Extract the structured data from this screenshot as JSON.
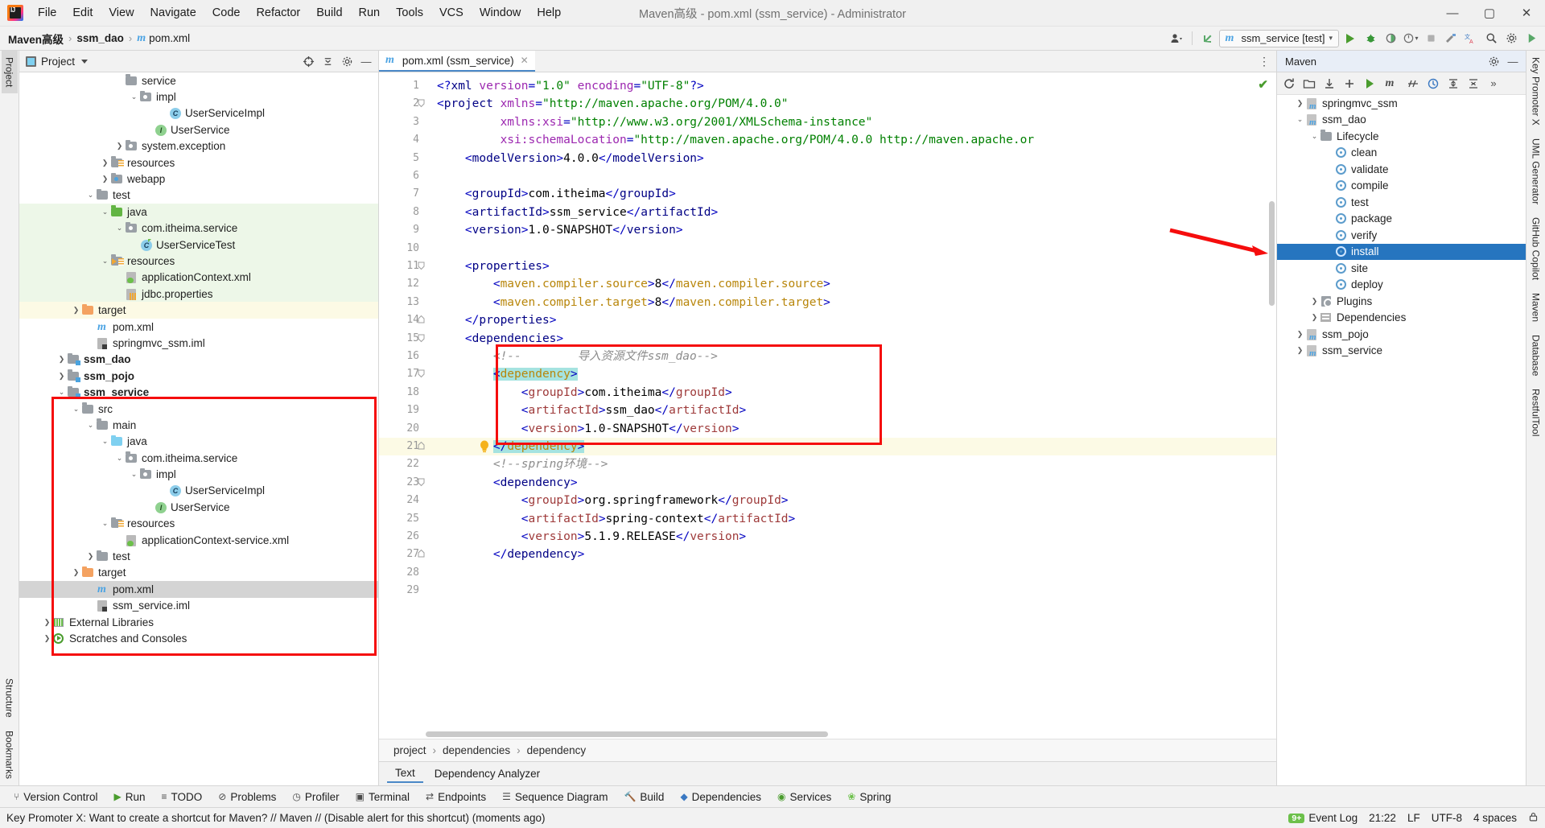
{
  "titlebar": {
    "menus": [
      "File",
      "Edit",
      "View",
      "Navigate",
      "Code",
      "Refactor",
      "Build",
      "Run",
      "Tools",
      "VCS",
      "Window",
      "Help"
    ],
    "window_title": "Maven高级 - pom.xml (ssm_service) - Administrator",
    "minimize": "—",
    "maximize": "▢",
    "close": "✕",
    "logo_name": "intellij-idea-logo"
  },
  "navbar": {
    "crumb1": "Maven高级",
    "crumb2": "ssm_dao",
    "crumb3": "pom.xml",
    "sep": "›",
    "run_config": "ssm_service [test]",
    "run_config_caret": "▾"
  },
  "left_strip": {
    "project_tab": "Project",
    "structure_tab": "Structure",
    "bookmarks_tab": "Bookmarks"
  },
  "right_strip": {
    "tabs": [
      "Key Promoter X",
      "UML Generator",
      "GitHub Copilot",
      "Maven",
      "Database",
      "RestfulTool"
    ]
  },
  "project_panel": {
    "title": "Project",
    "rows": [
      {
        "indent": 6,
        "arrow": "",
        "icon": "folder-grey",
        "label": "service",
        "bg": "",
        "bold": false,
        "clipped": true
      },
      {
        "indent": 7,
        "arrow": "v",
        "icon": "folder-pkg",
        "label": "impl",
        "bg": "",
        "bold": false
      },
      {
        "indent": 9,
        "arrow": "",
        "icon": "class-c",
        "label": "UserServiceImpl",
        "bg": "",
        "bold": false
      },
      {
        "indent": 8,
        "arrow": "",
        "icon": "interface-i",
        "label": "UserService",
        "bg": "",
        "bold": false
      },
      {
        "indent": 6,
        "arrow": ">",
        "icon": "folder-pkg",
        "label": "system.exception",
        "bg": "",
        "bold": false
      },
      {
        "indent": 5,
        "arrow": ">",
        "icon": "folder-res",
        "label": "resources",
        "bg": "",
        "bold": false
      },
      {
        "indent": 5,
        "arrow": ">",
        "icon": "folder-web",
        "label": "webapp",
        "bg": "",
        "bold": false
      },
      {
        "indent": 4,
        "arrow": "v",
        "icon": "folder-grey",
        "label": "test",
        "bg": "",
        "bold": false
      },
      {
        "indent": 5,
        "arrow": "v",
        "icon": "folder-green",
        "label": "java",
        "bg": "green",
        "bold": false
      },
      {
        "indent": 6,
        "arrow": "v",
        "icon": "folder-pkg",
        "label": "com.itheima.service",
        "bg": "green",
        "bold": false
      },
      {
        "indent": 7,
        "arrow": "",
        "icon": "class-test",
        "label": "UserServiceTest",
        "bg": "green",
        "bold": false
      },
      {
        "indent": 5,
        "arrow": "v",
        "icon": "folder-res-t",
        "label": "resources",
        "bg": "green",
        "bold": false
      },
      {
        "indent": 6,
        "arrow": "",
        "icon": "file-xml",
        "label": "applicationContext.xml",
        "bg": "green",
        "bold": false
      },
      {
        "indent": 6,
        "arrow": "",
        "icon": "file-prop",
        "label": "jdbc.properties",
        "bg": "green",
        "bold": false
      },
      {
        "indent": 3,
        "arrow": ">",
        "icon": "folder-orange",
        "label": "target",
        "bg": "yellow",
        "bold": false
      },
      {
        "indent": 4,
        "arrow": "",
        "icon": "file-pom",
        "label": "pom.xml",
        "bg": "",
        "bold": false
      },
      {
        "indent": 4,
        "arrow": "",
        "icon": "file-iml",
        "label": "springmvc_ssm.iml",
        "bg": "",
        "bold": false
      },
      {
        "indent": 2,
        "arrow": ">",
        "icon": "module-maven",
        "label": "ssm_dao",
        "bg": "",
        "bold": true
      },
      {
        "indent": 2,
        "arrow": ">",
        "icon": "module-maven",
        "label": "ssm_pojo",
        "bg": "",
        "bold": true
      },
      {
        "indent": 2,
        "arrow": "v",
        "icon": "module-maven",
        "label": "ssm_service",
        "bg": "",
        "bold": true
      },
      {
        "indent": 3,
        "arrow": "v",
        "icon": "folder-grey",
        "label": "src",
        "bg": "",
        "bold": false
      },
      {
        "indent": 4,
        "arrow": "v",
        "icon": "folder-grey",
        "label": "main",
        "bg": "",
        "bold": false
      },
      {
        "indent": 5,
        "arrow": "v",
        "icon": "folder-blue",
        "label": "java",
        "bg": "",
        "bold": false
      },
      {
        "indent": 6,
        "arrow": "v",
        "icon": "folder-pkg",
        "label": "com.itheima.service",
        "bg": "",
        "bold": false
      },
      {
        "indent": 7,
        "arrow": "v",
        "icon": "folder-pkg",
        "label": "impl",
        "bg": "",
        "bold": false
      },
      {
        "indent": 9,
        "arrow": "",
        "icon": "class-c",
        "label": "UserServiceImpl",
        "bg": "",
        "bold": false
      },
      {
        "indent": 8,
        "arrow": "",
        "icon": "interface-i",
        "label": "UserService",
        "bg": "",
        "bold": false
      },
      {
        "indent": 5,
        "arrow": "v",
        "icon": "folder-res",
        "label": "resources",
        "bg": "",
        "bold": false
      },
      {
        "indent": 6,
        "arrow": "",
        "icon": "file-xml",
        "label": "applicationContext-service.xml",
        "bg": "",
        "bold": false
      },
      {
        "indent": 4,
        "arrow": ">",
        "icon": "folder-grey",
        "label": "test",
        "bg": "",
        "bold": false
      },
      {
        "indent": 3,
        "arrow": ">",
        "icon": "folder-orange",
        "label": "target",
        "bg": "",
        "bold": false
      },
      {
        "indent": 4,
        "arrow": "",
        "icon": "file-pom",
        "label": "pom.xml",
        "bg": "sel",
        "bold": false
      },
      {
        "indent": 4,
        "arrow": "",
        "icon": "file-iml",
        "label": "ssm_service.iml",
        "bg": "",
        "bold": false
      },
      {
        "indent": 1,
        "arrow": ">",
        "icon": "lib-icon",
        "label": "External Libraries",
        "bg": "",
        "bold": false
      },
      {
        "indent": 1,
        "arrow": ">",
        "icon": "scratch-icon",
        "label": "Scratches and Consoles",
        "bg": "",
        "bold": false
      }
    ]
  },
  "editor": {
    "tab_label": "pom.xml (ssm_service)",
    "tab_close": "✕",
    "breadcrumbs": [
      "project",
      "dependencies",
      "dependency"
    ],
    "bottom_tabs": [
      {
        "label": "Text",
        "selected": true
      },
      {
        "label": "Dependency Analyzer",
        "selected": false
      }
    ],
    "inspection_ok": "✔",
    "lines": [
      {
        "n": 1,
        "indent": 0,
        "fold": "",
        "html": "<span class='tk-ang'>&lt;?</span><span class='tk-tag'>xml </span><span class='tk-attr'>version</span><span class='tk-ang'>=</span><span class='tk-str'>\"1.0\"</span> <span class='tk-attr'>encoding</span><span class='tk-ang'>=</span><span class='tk-str'>\"UTF-8\"</span><span class='tk-ang'>?&gt;</span>"
      },
      {
        "n": 2,
        "indent": 0,
        "fold": "v",
        "html": "<span class='tk-ang'>&lt;</span><span class='tk-tag'>project</span> <span class='tk-attr'>xmlns</span><span class='tk-ang'>=</span><span class='tk-str'>\"http://maven.apache.org/POM/4.0.0\"</span>"
      },
      {
        "n": 3,
        "indent": 0,
        "fold": "",
        "html": "         <span class='tk-attr'>xmlns:xsi</span><span class='tk-ang'>=</span><span class='tk-str'>\"http://www.w3.org/2001/XMLSchema-instance\"</span>"
      },
      {
        "n": 4,
        "indent": 0,
        "fold": "",
        "html": "         <span class='tk-attr'>xsi:schemaLocation</span><span class='tk-ang'>=</span><span class='tk-str'>\"http://maven.apache.org/POM/4.0.0 http://maven.apache.or</span>"
      },
      {
        "n": 5,
        "indent": 0,
        "fold": "",
        "html": "    <span class='tk-ang'>&lt;</span><span class='tk-tag'>modelVersion</span><span class='tk-ang'>&gt;</span><span class='tk-txt'>4.0.0</span><span class='tk-ang'>&lt;/</span><span class='tk-tag'>modelVersion</span><span class='tk-ang'>&gt;</span>"
      },
      {
        "n": 6,
        "indent": 0,
        "fold": "",
        "html": ""
      },
      {
        "n": 7,
        "indent": 0,
        "fold": "",
        "html": "    <span class='tk-ang'>&lt;</span><span class='tk-tag'>groupId</span><span class='tk-ang'>&gt;</span><span class='tk-txt'>com.itheima</span><span class='tk-ang'>&lt;/</span><span class='tk-tag'>groupId</span><span class='tk-ang'>&gt;</span>"
      },
      {
        "n": 8,
        "indent": 0,
        "fold": "",
        "html": "    <span class='tk-ang'>&lt;</span><span class='tk-tag'>artifactId</span><span class='tk-ang'>&gt;</span><span class='tk-txt'>ssm_service</span><span class='tk-ang'>&lt;/</span><span class='tk-tag'>artifactId</span><span class='tk-ang'>&gt;</span>"
      },
      {
        "n": 9,
        "indent": 0,
        "fold": "",
        "html": "    <span class='tk-ang'>&lt;</span><span class='tk-tag'>version</span><span class='tk-ang'>&gt;</span><span class='tk-txt'>1.0-SNAPSHOT</span><span class='tk-ang'>&lt;/</span><span class='tk-tag'>version</span><span class='tk-ang'>&gt;</span>"
      },
      {
        "n": 10,
        "indent": 0,
        "fold": "",
        "html": ""
      },
      {
        "n": 11,
        "indent": 0,
        "fold": "v",
        "html": "    <span class='tk-ang'>&lt;</span><span class='tk-tag'>properties</span><span class='tk-ang'>&gt;</span>"
      },
      {
        "n": 12,
        "indent": 0,
        "fold": "",
        "html": "        <span class='tk-ang'>&lt;</span><span class='tk-prop'>maven.compiler.source</span><span class='tk-ang'>&gt;</span><span class='tk-txt'>8</span><span class='tk-ang'>&lt;/</span><span class='tk-prop'>maven.compiler.source</span><span class='tk-ang'>&gt;</span>"
      },
      {
        "n": 13,
        "indent": 0,
        "fold": "",
        "html": "        <span class='tk-ang'>&lt;</span><span class='tk-prop'>maven.compiler.target</span><span class='tk-ang'>&gt;</span><span class='tk-txt'>8</span><span class='tk-ang'>&lt;/</span><span class='tk-prop'>maven.compiler.target</span><span class='tk-ang'>&gt;</span>"
      },
      {
        "n": 14,
        "indent": 0,
        "fold": "^",
        "html": "    <span class='tk-ang'>&lt;/</span><span class='tk-tag'>properties</span><span class='tk-ang'>&gt;</span>"
      },
      {
        "n": 15,
        "indent": 0,
        "fold": "v",
        "html": "    <span class='tk-ang'>&lt;</span><span class='tk-tag'>dependencies</span><span class='tk-ang'>&gt;</span>"
      },
      {
        "n": 16,
        "indent": 0,
        "fold": "",
        "html": "        <span class='tk-com'>&lt;!--        导入资源文件ssm_dao--&gt;</span>"
      },
      {
        "n": 17,
        "indent": 0,
        "fold": "v",
        "html": "        <span class='tk-sel'><span class='tk-ang'>&lt;</span><span class='tk-prop'>dependency</span><span class='tk-ang'>&gt;</span></span>"
      },
      {
        "n": 18,
        "indent": 0,
        "fold": "",
        "html": "            <span class='tk-ang'>&lt;</span><span class='tk-name'>groupId</span><span class='tk-ang'>&gt;</span><span class='tk-txt'>com.itheima</span><span class='tk-ang'>&lt;/</span><span class='tk-name'>groupId</span><span class='tk-ang'>&gt;</span>"
      },
      {
        "n": 19,
        "indent": 0,
        "fold": "",
        "html": "            <span class='tk-ang'>&lt;</span><span class='tk-name'>artifactId</span><span class='tk-ang'>&gt;</span><span class='tk-txt'>ssm_dao</span><span class='tk-ang'>&lt;/</span><span class='tk-name'>artifactId</span><span class='tk-ang'>&gt;</span>"
      },
      {
        "n": 20,
        "indent": 0,
        "fold": "",
        "html": "            <span class='tk-ang'>&lt;</span><span class='tk-name'>version</span><span class='tk-ang'>&gt;</span><span class='tk-txt'>1.0-SNAPSHOT</span><span class='tk-ang'>&lt;/</span><span class='tk-name'>version</span><span class='tk-ang'>&gt;</span>"
      },
      {
        "n": 21,
        "indent": 0,
        "fold": "^",
        "html": "        <span class='tk-sel'><span class='tk-ang'>&lt;/</span><span class='tk-prop'>dependency</span><span class='tk-ang'>&gt;</span></span>",
        "highlight": true,
        "bulb": true
      },
      {
        "n": 22,
        "indent": 0,
        "fold": "",
        "html": "        <span class='tk-com'>&lt;!--spring环境--&gt;</span>"
      },
      {
        "n": 23,
        "indent": 0,
        "fold": "v",
        "html": "        <span class='tk-ang'>&lt;</span><span class='tk-tag'>dependency</span><span class='tk-ang'>&gt;</span>"
      },
      {
        "n": 24,
        "indent": 0,
        "fold": "",
        "html": "            <span class='tk-ang'>&lt;</span><span class='tk-name'>groupId</span><span class='tk-ang'>&gt;</span><span class='tk-txt'>org.springframework</span><span class='tk-ang'>&lt;/</span><span class='tk-name'>groupId</span><span class='tk-ang'>&gt;</span>"
      },
      {
        "n": 25,
        "indent": 0,
        "fold": "",
        "html": "            <span class='tk-ang'>&lt;</span><span class='tk-name'>artifactId</span><span class='tk-ang'>&gt;</span><span class='tk-txt'>spring-context</span><span class='tk-ang'>&lt;/</span><span class='tk-name'>artifactId</span><span class='tk-ang'>&gt;</span>"
      },
      {
        "n": 26,
        "indent": 0,
        "fold": "",
        "html": "            <span class='tk-ang'>&lt;</span><span class='tk-name'>version</span><span class='tk-ang'>&gt;</span><span class='tk-txt'>5.1.9.RELEASE</span><span class='tk-ang'>&lt;/</span><span class='tk-name'>version</span><span class='tk-ang'>&gt;</span>"
      },
      {
        "n": 27,
        "indent": 0,
        "fold": "^",
        "html": "        <span class='tk-ang'>&lt;/</span><span class='tk-tag'>dependency</span><span class='tk-ang'>&gt;</span>"
      },
      {
        "n": 28,
        "indent": 0,
        "fold": "",
        "html": ""
      },
      {
        "n": 29,
        "indent": 0,
        "fold": "",
        "html": ""
      }
    ]
  },
  "maven_panel": {
    "title": "Maven",
    "rows": [
      {
        "indent": 1,
        "arrow": ">",
        "icon": "maven-module",
        "label": "springmvc_ssm",
        "sel": false
      },
      {
        "indent": 1,
        "arrow": "v",
        "icon": "maven-module",
        "label": "ssm_dao",
        "sel": false
      },
      {
        "indent": 2,
        "arrow": "v",
        "icon": "lifecycle",
        "label": "Lifecycle",
        "sel": false
      },
      {
        "indent": 3,
        "arrow": "",
        "icon": "phase",
        "label": "clean",
        "sel": false
      },
      {
        "indent": 3,
        "arrow": "",
        "icon": "phase",
        "label": "validate",
        "sel": false
      },
      {
        "indent": 3,
        "arrow": "",
        "icon": "phase",
        "label": "compile",
        "sel": false
      },
      {
        "indent": 3,
        "arrow": "",
        "icon": "phase",
        "label": "test",
        "sel": false
      },
      {
        "indent": 3,
        "arrow": "",
        "icon": "phase",
        "label": "package",
        "sel": false
      },
      {
        "indent": 3,
        "arrow": "",
        "icon": "phase",
        "label": "verify",
        "sel": false
      },
      {
        "indent": 3,
        "arrow": "",
        "icon": "phase",
        "label": "install",
        "sel": true
      },
      {
        "indent": 3,
        "arrow": "",
        "icon": "phase",
        "label": "site",
        "sel": false
      },
      {
        "indent": 3,
        "arrow": "",
        "icon": "phase",
        "label": "deploy",
        "sel": false
      },
      {
        "indent": 2,
        "arrow": ">",
        "icon": "plugins",
        "label": "Plugins",
        "sel": false
      },
      {
        "indent": 2,
        "arrow": ">",
        "icon": "dependencies",
        "label": "Dependencies",
        "sel": false
      },
      {
        "indent": 1,
        "arrow": ">",
        "icon": "maven-module",
        "label": "ssm_pojo",
        "sel": false
      },
      {
        "indent": 1,
        "arrow": ">",
        "icon": "maven-module",
        "label": "ssm_service",
        "sel": false
      }
    ]
  },
  "bottom_bar": {
    "items": [
      {
        "icon": "branch-icon",
        "label": "Version Control"
      },
      {
        "icon": "run-icon",
        "label": "Run"
      },
      {
        "icon": "todo-icon",
        "label": "TODO"
      },
      {
        "icon": "problems-icon",
        "label": "Problems"
      },
      {
        "icon": "profiler-icon",
        "label": "Profiler"
      },
      {
        "icon": "terminal-icon",
        "label": "Terminal"
      },
      {
        "icon": "endpoints-icon",
        "label": "Endpoints"
      },
      {
        "icon": "sequence-icon",
        "label": "Sequence Diagram"
      },
      {
        "icon": "build-icon",
        "label": "Build"
      },
      {
        "icon": "dependencies-icon",
        "label": "Dependencies"
      },
      {
        "icon": "services-icon",
        "label": "Services"
      },
      {
        "icon": "spring-icon",
        "label": "Spring"
      }
    ]
  },
  "status_bar": {
    "message": "Key Promoter X: Want to create a shortcut for Maven? // Maven // (Disable alert for this shortcut) (moments ago)",
    "time": "21:22",
    "line_sep": "LF",
    "encoding": "UTF-8",
    "indent": "4 spaces",
    "event_log": "Event Log",
    "event_badge": "9+"
  },
  "colors": {
    "accent_blue": "#2675bf",
    "annotation_red": "#f50d0d",
    "green_source": "#edf7e8",
    "yellow_target": "#fcfae5",
    "selection_grey": "#d4d4d4",
    "code_selection": "#a5e3e0"
  }
}
